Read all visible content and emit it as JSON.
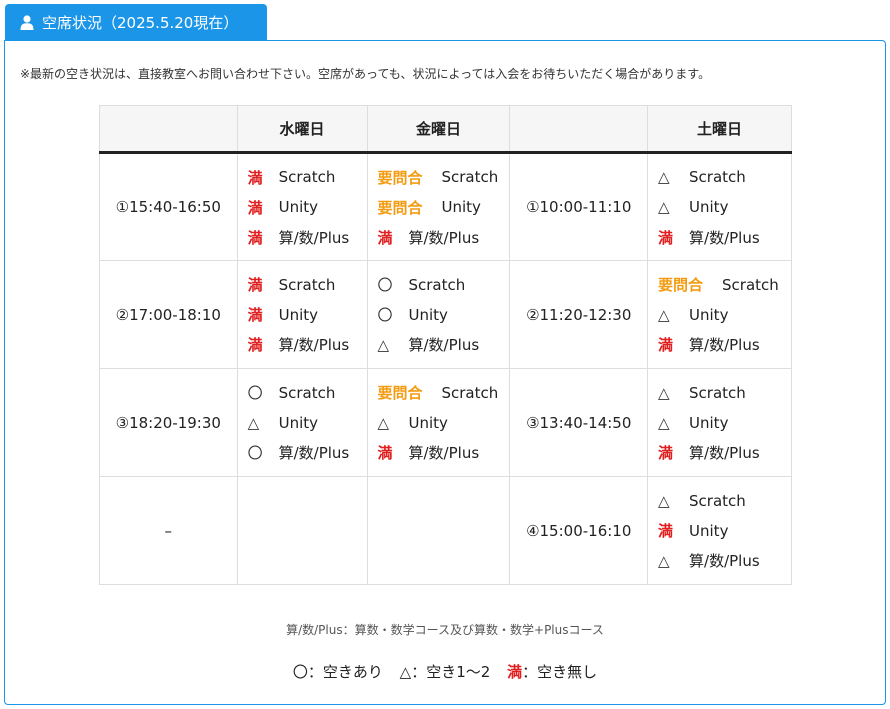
{
  "tab": {
    "title": "空席状況（2025.5.20現在）",
    "icon": "user-icon"
  },
  "notice": "※最新の空き状況は、直接教室へお問い合わせ下さい。空席があっても、状況によっては入会をお待ちいただく場合があります。",
  "table": {
    "headers": [
      "",
      "水曜日",
      "金曜日",
      "",
      "土曜日"
    ],
    "rows": [
      {
        "wed_time": "①15:40-16:50",
        "wed": [
          {
            "mark": "満",
            "course": "Scratch"
          },
          {
            "mark": "満",
            "course": "Unity"
          },
          {
            "mark": "満",
            "course": "算/数/Plus"
          }
        ],
        "fri": [
          {
            "mark": "要問合",
            "course": "Scratch"
          },
          {
            "mark": "要問合",
            "course": "Unity"
          },
          {
            "mark": "満",
            "course": "算/数/Plus"
          }
        ],
        "sat_time": "①10:00-11:10",
        "sat": [
          {
            "mark": "△",
            "course": "Scratch"
          },
          {
            "mark": "△",
            "course": "Unity"
          },
          {
            "mark": "満",
            "course": "算/数/Plus"
          }
        ]
      },
      {
        "wed_time": "②17:00-18:10",
        "wed": [
          {
            "mark": "満",
            "course": "Scratch"
          },
          {
            "mark": "満",
            "course": "Unity"
          },
          {
            "mark": "満",
            "course": "算/数/Plus"
          }
        ],
        "fri": [
          {
            "mark": "〇",
            "course": "Scratch"
          },
          {
            "mark": "〇",
            "course": "Unity"
          },
          {
            "mark": "△",
            "course": "算/数/Plus"
          }
        ],
        "sat_time": "②11:20-12:30",
        "sat": [
          {
            "mark": "要問合",
            "course": "Scratch"
          },
          {
            "mark": "△",
            "course": "Unity"
          },
          {
            "mark": "満",
            "course": "算/数/Plus"
          }
        ]
      },
      {
        "wed_time": "③18:20-19:30",
        "wed": [
          {
            "mark": "〇",
            "course": "Scratch"
          },
          {
            "mark": "△",
            "course": "Unity"
          },
          {
            "mark": "〇",
            "course": "算/数/Plus"
          }
        ],
        "fri": [
          {
            "mark": "要問合",
            "course": "Scratch"
          },
          {
            "mark": "△",
            "course": "Unity"
          },
          {
            "mark": "満",
            "course": "算/数/Plus"
          }
        ],
        "sat_time": "③13:40-14:50",
        "sat": [
          {
            "mark": "△",
            "course": "Scratch"
          },
          {
            "mark": "△",
            "course": "Unity"
          },
          {
            "mark": "満",
            "course": "算/数/Plus"
          }
        ]
      },
      {
        "wed_time": "–",
        "wed": [],
        "fri": [],
        "sat_time": "④15:00-16:10",
        "sat": [
          {
            "mark": "△",
            "course": "Scratch"
          },
          {
            "mark": "満",
            "course": "Unity"
          },
          {
            "mark": "△",
            "course": "算/数/Plus"
          }
        ]
      }
    ]
  },
  "note": "算/数/Plus：算数・数学コース及び算数・数学+Plusコース",
  "legend": {
    "ok": "〇：空きあり",
    "few": "△：空き1～2",
    "full_mark": "満",
    "full_text": "：空き無し"
  },
  "colors": {
    "accent": "#1a95e8",
    "full": "#e02020",
    "ask": "#f39c12"
  }
}
